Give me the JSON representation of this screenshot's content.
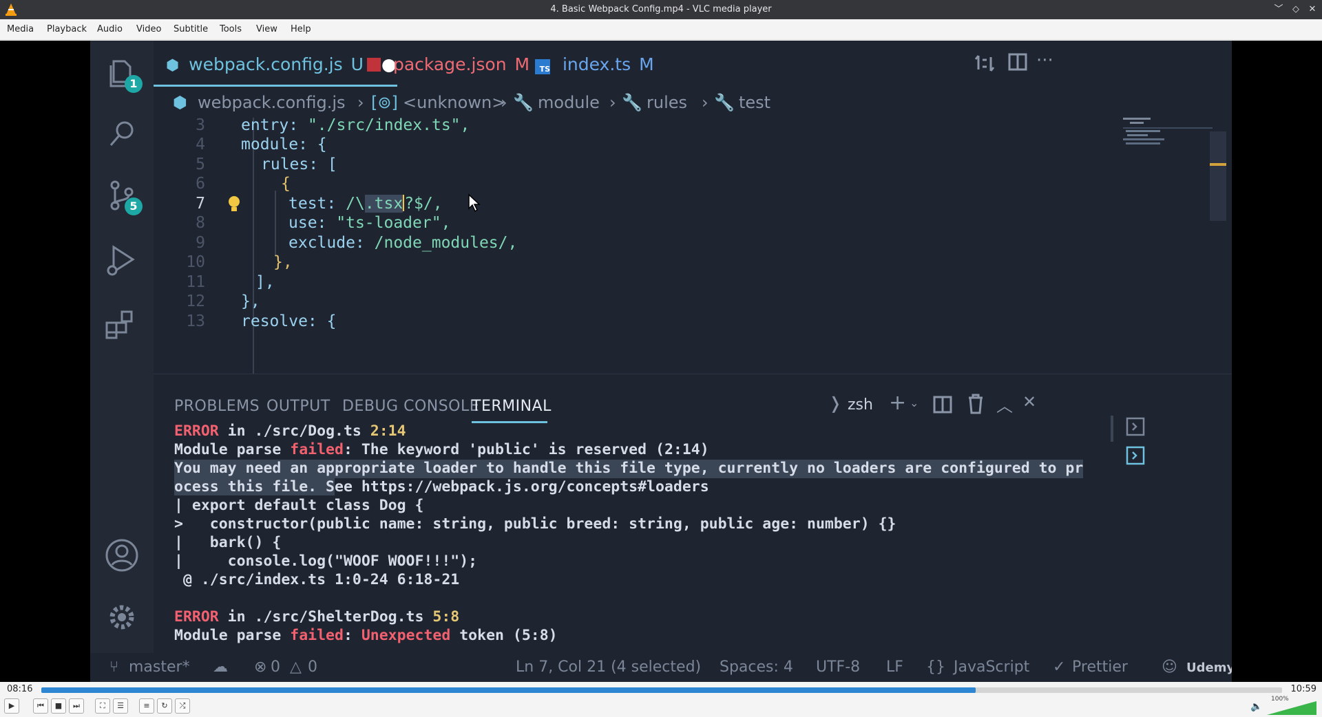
{
  "window": {
    "title": "4. Basic Webpack Config.mp4 - VLC media player"
  },
  "menu": [
    "Media",
    "Playback",
    "Audio",
    "Video",
    "Subtitle",
    "Tools",
    "View",
    "Help"
  ],
  "vscode": {
    "activity_badges": {
      "explorer": "1",
      "source_control": "5"
    },
    "tabs": [
      {
        "name": "webpack.config.js",
        "status": "U"
      },
      {
        "name": "package.json",
        "status": "M"
      },
      {
        "name": "index.ts",
        "status": "M"
      }
    ],
    "breadcrumb": [
      "webpack.config.js",
      "<unknown>",
      "module",
      "rules",
      "test"
    ],
    "line_numbers": [
      "3",
      "4",
      "5",
      "6",
      "7",
      "8",
      "9",
      "10",
      "11",
      "12",
      "13"
    ],
    "code": {
      "l3_key": "entry:",
      "l3_val": "\"./src/index.ts\",",
      "l4": "module: {",
      "l5": "rules: [",
      "l6": "{",
      "l7_key": "test:",
      "l7_a": "/\\",
      "l7_sel": ".tsx",
      "l7_b": "?$/,",
      "l8_key": "use:",
      "l8_val": "\"ts-loader\",",
      "l9_key": "exclude:",
      "l9_val": "/node_modules/,",
      "l10": "},",
      "l11": "],",
      "l12": "},",
      "l13": "resolve: {"
    },
    "panel_tabs": [
      "PROBLEMS",
      "OUTPUT",
      "DEBUG CONSOLE",
      "TERMINAL"
    ],
    "terminal_shell": "zsh",
    "terminal": {
      "e1_label": "ERROR",
      "e1_rest": " in ./src/Dog.ts ",
      "e1_pos": "2:14",
      "m1_a": "Module parse ",
      "m1_failed": "failed",
      "m1_b": ": The keyword 'public' is reserved (2:14)",
      "l3": "You may need an appropriate loader to handle this file type, currently no loaders are configured to pr",
      "l4_sel": "ocess this file. S",
      "l4_rest": "ee https://webpack.js.org/concepts#loaders",
      "l5": "| export default class Dog {",
      "l6": ">   constructor(public name: string, public breed: string, public age: number) {}",
      "l7": "|   bark() {",
      "l8": "|     console.log(\"WOOF WOOF!!!\");",
      "l9": " @ ./src/index.ts 1:0-24 6:18-21",
      "e2_label": "ERROR",
      "e2_rest": " in ./src/ShelterDog.ts ",
      "e2_pos": "5:8",
      "m2_a": "Module parse ",
      "m2_failed": "failed",
      "m2_b": ": ",
      "m2_token": "Unexpected",
      "m2_c": " token (5:8)"
    },
    "status": {
      "branch": "master*",
      "errors": "0",
      "warnings": "0",
      "cursor": "Ln 7, Col 21 (4 selected)",
      "spaces": "Spaces: 4",
      "encoding": "UTF-8",
      "eol": "LF",
      "language": "JavaScript",
      "formatter": "Prettier",
      "watermark": "Udemy"
    }
  },
  "player": {
    "elapsed": "08:16",
    "total": "10:59",
    "progress": 0.753,
    "volume_label": "100%",
    "volume": 1.0
  },
  "colors": {
    "accent": "#2c86d2",
    "editor_bg": "#1e2430",
    "error": "#f2616f",
    "badge": "#1ea8a5"
  }
}
